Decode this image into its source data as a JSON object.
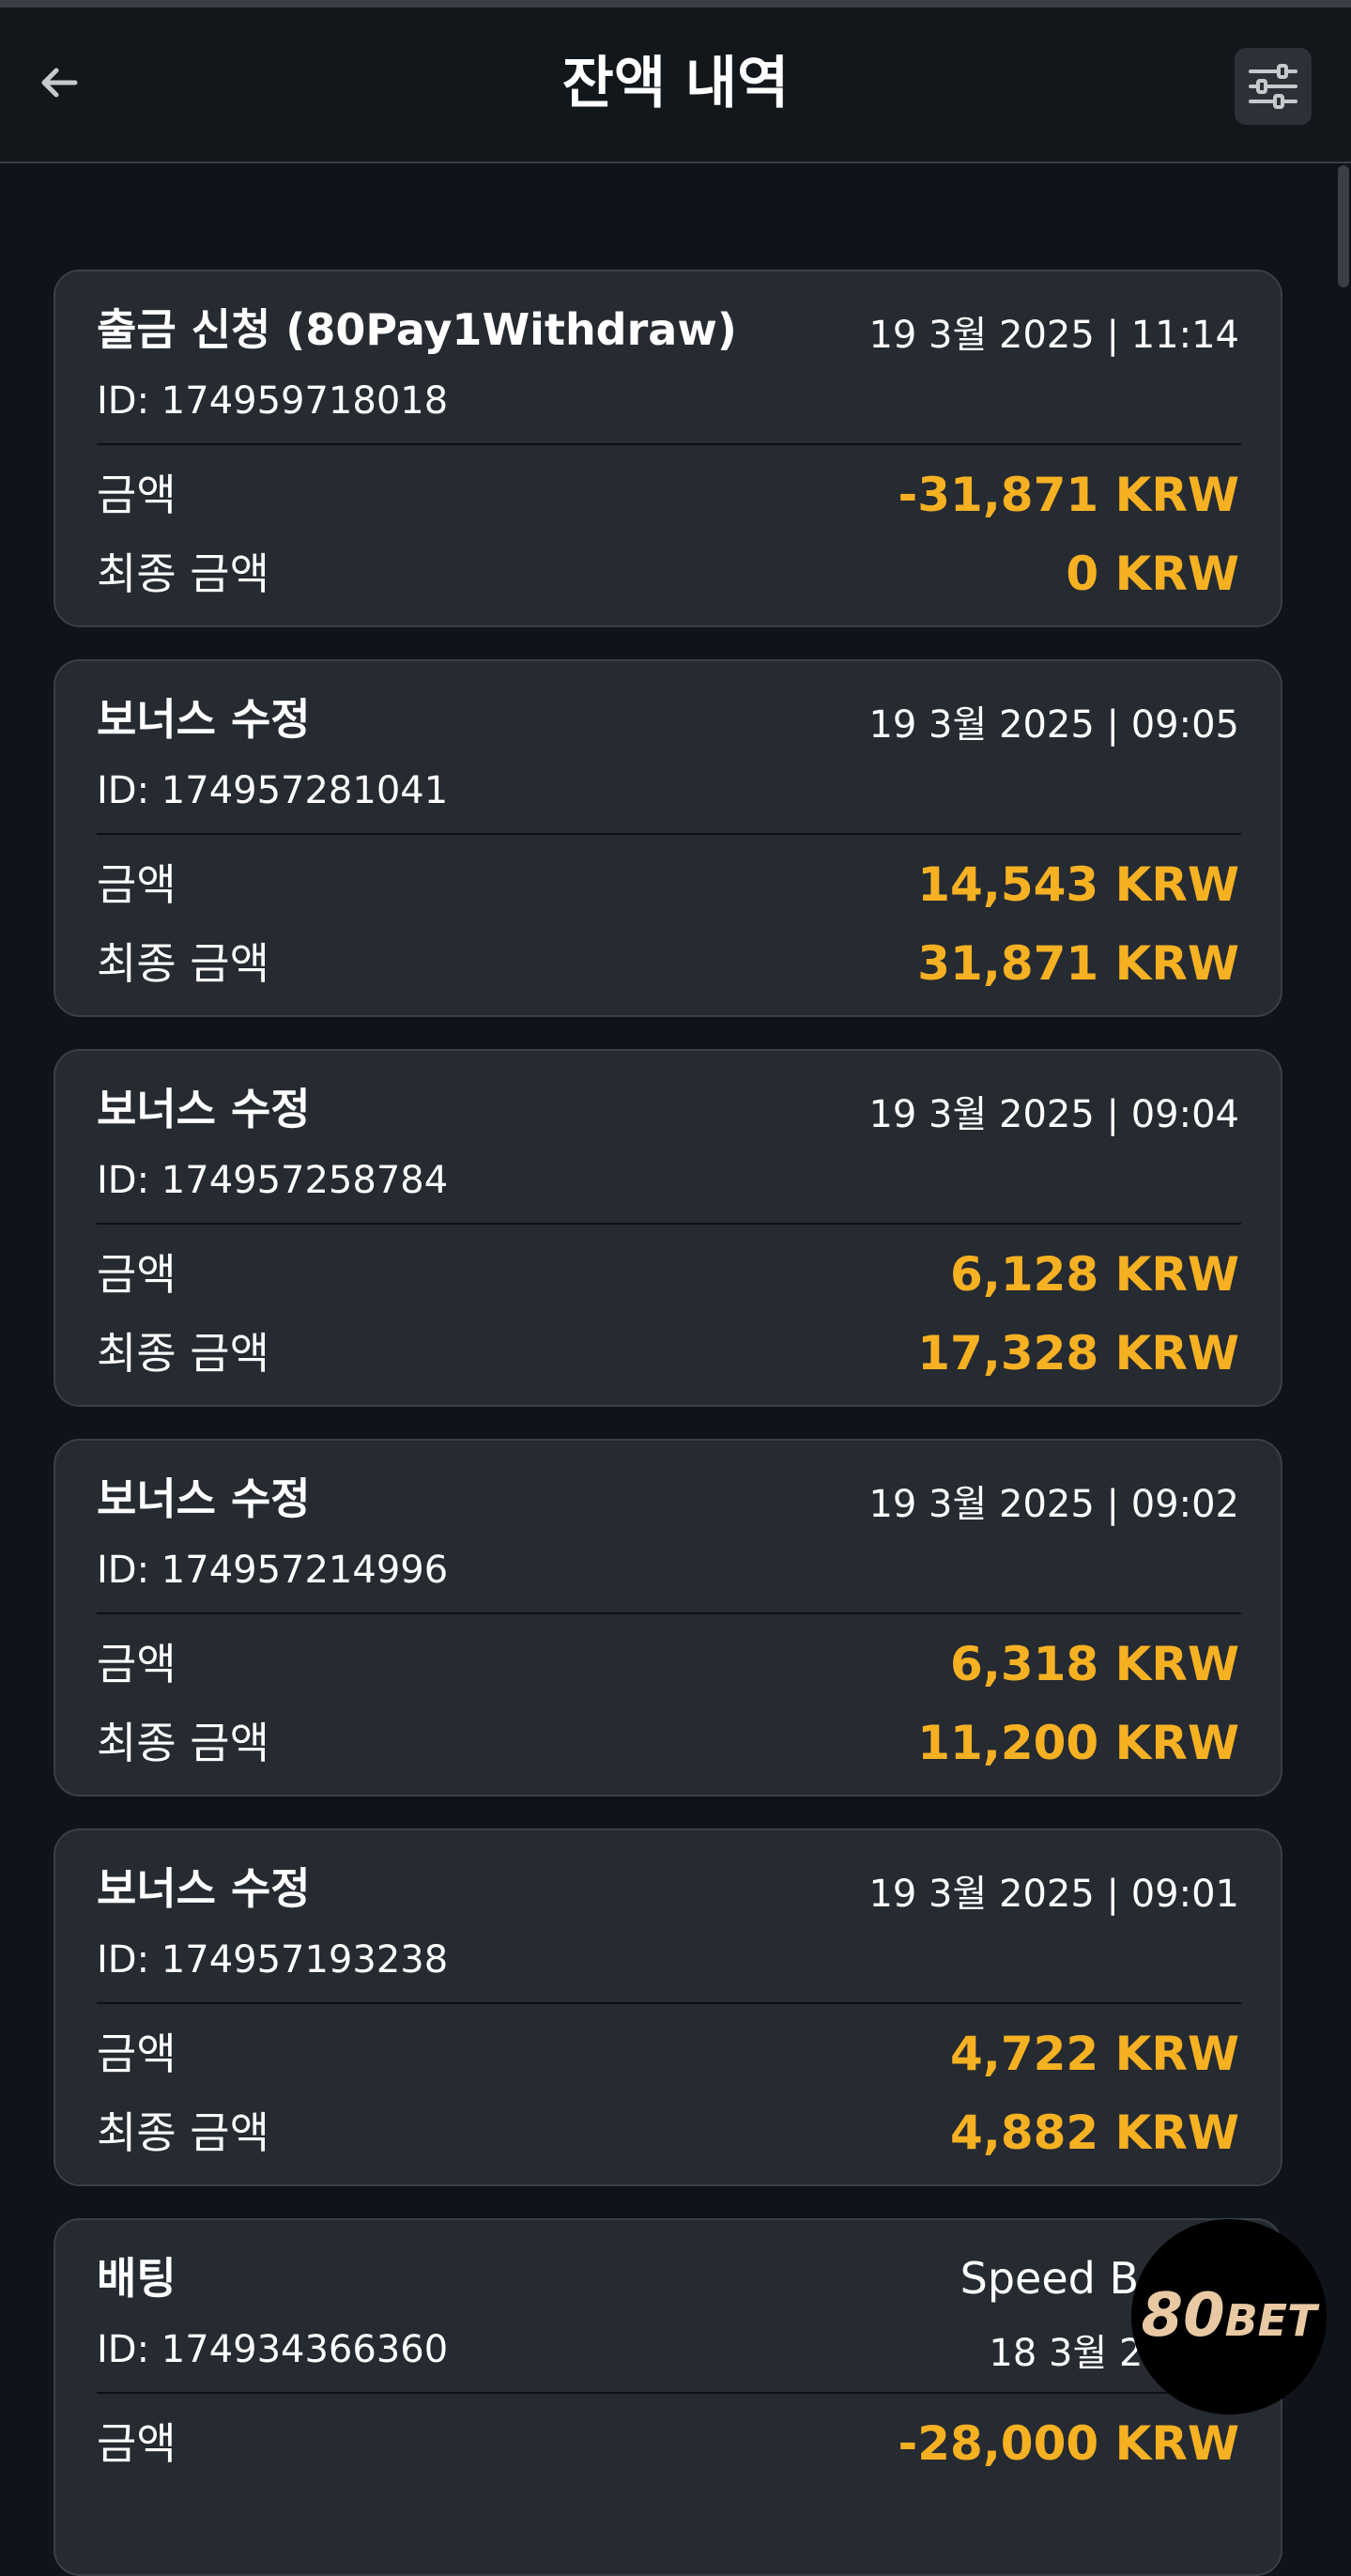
{
  "header": {
    "title": "잔액 내역",
    "back_icon": "arrow-left-icon",
    "filter_icon": "sliders-icon"
  },
  "labels": {
    "amount": "금액",
    "final_amount": "최종 금액"
  },
  "colors": {
    "background": "#0e1419",
    "card": "#262a31",
    "accent": "#f6b123"
  },
  "transactions": [
    {
      "type": "출금 신청 (80Pay1Withdraw)",
      "datetime": "19 3월 2025 | 11:14",
      "id": "ID: 174959718018",
      "amount": "-31,871 KRW",
      "final_amount": "0 KRW"
    },
    {
      "type": "보너스 수정",
      "datetime": "19 3월 2025 | 09:05",
      "id": "ID: 174957281041",
      "amount": "14,543 KRW",
      "final_amount": "31,871 KRW"
    },
    {
      "type": "보너스 수정",
      "datetime": "19 3월 2025 | 09:04",
      "id": "ID: 174957258784",
      "amount": "6,128 KRW",
      "final_amount": "17,328 KRW"
    },
    {
      "type": "보너스 수정",
      "datetime": "19 3월 2025 | 09:02",
      "id": "ID: 174957214996",
      "amount": "6,318 KRW",
      "final_amount": "11,200 KRW"
    },
    {
      "type": "보너스 수정",
      "datetime": "19 3월 2025 | 09:01",
      "id": "ID: 174957193238",
      "amount": "4,722 KRW",
      "final_amount": "4,882 KRW"
    },
    {
      "type": "배팅",
      "game": "Speed Bacca",
      "datetime": "18 3월 2025 |",
      "id": "ID: 174934366360",
      "amount": "-28,000 KRW"
    }
  ],
  "logo": {
    "text": "80BET"
  }
}
